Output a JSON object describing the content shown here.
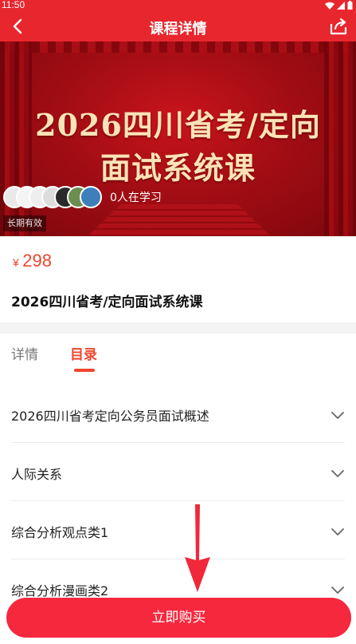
{
  "status_bar": {
    "time": "11:50",
    "wifi_icon": "wifi-icon",
    "signal_icon": "signal-icon",
    "battery_icon": "battery-icon"
  },
  "nav": {
    "title": "课程详情",
    "back_icon": "back-arrow-icon",
    "share_icon": "share-icon"
  },
  "banner": {
    "title_line1": "2026四川省考/定向",
    "title_line2": "面试系统课",
    "learner_count_text": "0人在学习",
    "validity": "长期有效",
    "avatar_colors": [
      "#e9e9e9",
      "#f4f4f4",
      "#eeeeee",
      "#dcdcdc",
      "#2a2a2a",
      "#6b8e4e",
      "#3d7fb8"
    ]
  },
  "course": {
    "price_symbol": "¥",
    "price_value": "298",
    "name": "2026四川省考/定向面试系统课"
  },
  "tabs": [
    {
      "label": "详情"
    },
    {
      "label": "目录"
    }
  ],
  "active_tab": "目录",
  "catalog": [
    {
      "title": "2026四川省考定向公务员面试概述"
    },
    {
      "title": "人际关系"
    },
    {
      "title": "综合分析观点类1"
    },
    {
      "title": "综合分析漫画类2"
    }
  ],
  "buy_button": {
    "label": "立即购买"
  },
  "colors": {
    "brand_red": "#e8262e",
    "accent_orange": "#f0462f",
    "button_red": "#f6283e",
    "banner_text": "#fbe3b8"
  }
}
